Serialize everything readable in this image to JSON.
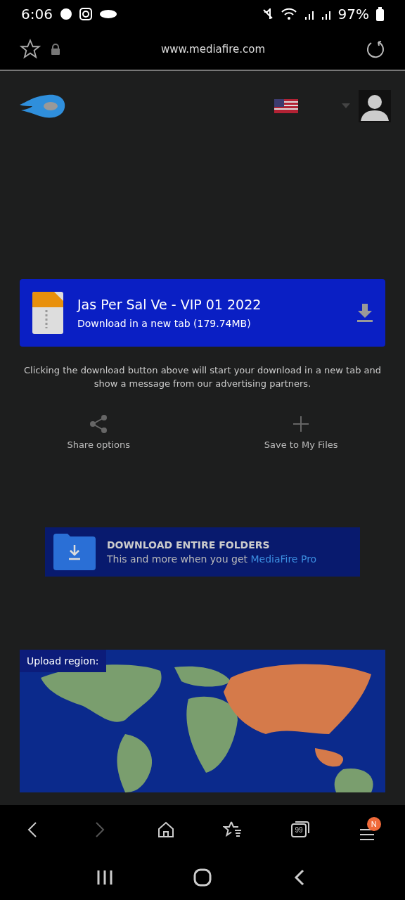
{
  "status_bar": {
    "time": "6:06",
    "battery": "97%"
  },
  "address_bar": {
    "url": "www.mediafire.com"
  },
  "download": {
    "file_name": "Jas Per Sal Ve - VIP 01 2022",
    "subtitle": "Download in a new tab (179.74MB)"
  },
  "notice": "Clicking the download button above will start your download in a new tab and show a message from our advertising partners.",
  "actions": [
    {
      "kind": "share",
      "label": "Share options"
    },
    {
      "kind": "save",
      "label": "Save to My Files"
    }
  ],
  "promo": {
    "title": "DOWNLOAD ENTIRE FOLDERS",
    "text": "This and more when you get",
    "link": "MediaFire Pro"
  },
  "upload_region": {
    "label": "Upload region:",
    "kind": "picture"
  },
  "browser_toolbar": {
    "back_disabled": false,
    "forward_disabled": true,
    "tab_count": "99",
    "menu_badge": "N"
  }
}
